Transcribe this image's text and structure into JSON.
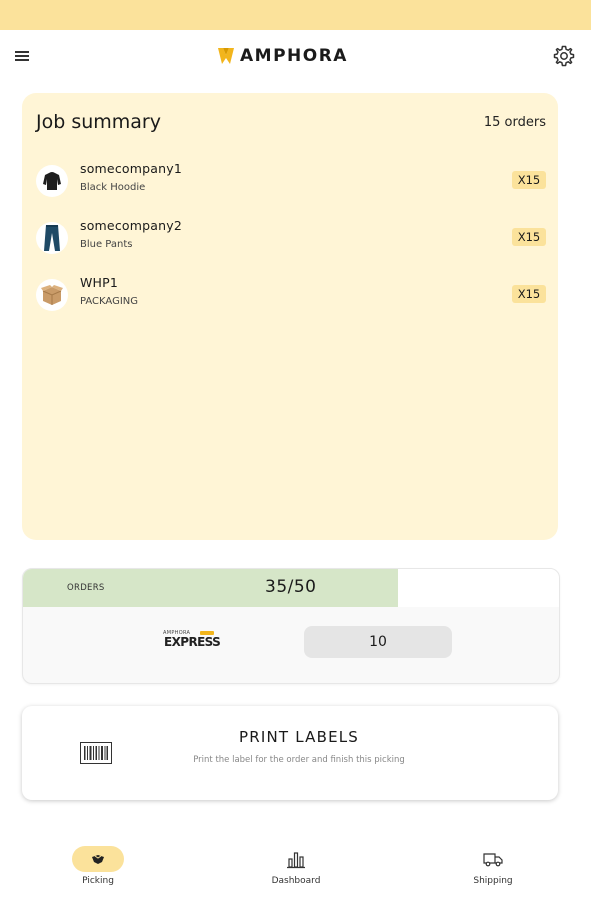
{
  "app": {
    "brand": "AMPHORA",
    "brand_color": "#f2b51c",
    "accent": "#fbe29b"
  },
  "header": {
    "menu_icon": "hamburger-menu-icon",
    "settings_icon": "gear-icon"
  },
  "summary": {
    "title": "Job summary",
    "count": "15 orders",
    "items": [
      {
        "company": "somecompany1",
        "product": "Black Hoodie",
        "qty": "X15",
        "icon": "hoodie-icon"
      },
      {
        "company": "somecompany2",
        "product": "Blue Pants",
        "qty": "X15",
        "icon": "pants-icon"
      },
      {
        "company": "WHP1",
        "product": "PACKAGING",
        "qty": "X15",
        "icon": "box-icon"
      }
    ]
  },
  "orders": {
    "label": "ORDERS",
    "value": "35/50",
    "progress": 0.7,
    "progress_color": "#d6e6c8",
    "carrier": {
      "logo_top": "AMPHORA",
      "logo_name": "EXPRESS",
      "qty": "10"
    }
  },
  "print": {
    "title": "PRINT LABELS",
    "subtitle": "Print the label for the order and finish this picking",
    "icon": "barcode-icon"
  },
  "nav": {
    "items": [
      {
        "label": "Picking",
        "icon": "picking-icon",
        "active": true
      },
      {
        "label": "Dashboard",
        "icon": "bar-chart-icon",
        "active": false
      },
      {
        "label": "Shipping",
        "icon": "truck-icon",
        "active": false
      }
    ]
  }
}
